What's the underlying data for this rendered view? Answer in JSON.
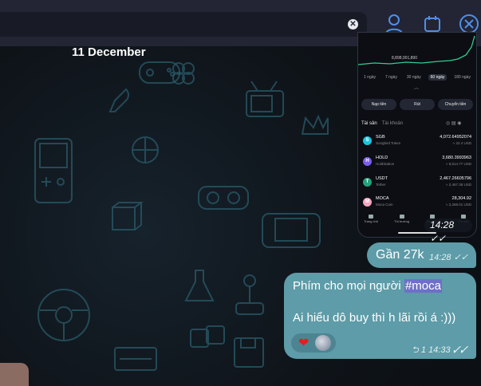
{
  "search": {
    "value": "",
    "clear_icon": "close-circle-icon"
  },
  "topbar": {
    "icons": [
      "person-icon",
      "calendar-icon",
      "close-icon"
    ]
  },
  "chat": {
    "date_label": "11 December",
    "screenshot": {
      "chart_value": "8,898,001,890",
      "ranges": [
        "1 ngày",
        "7 ngày",
        "30 ngày",
        "60 ngày",
        "180 ngày"
      ],
      "active_range": "60 ngày",
      "actions": [
        "Nạp tiền",
        "Rút",
        "Chuyển tiền"
      ],
      "tabs": {
        "active": "Tài sản",
        "other": "Tài khoản"
      },
      "assets": [
        {
          "symbol": "SGB",
          "name": "Songbird Token",
          "amount": "4,072.64952074",
          "usd": "≈ 22.4 USD",
          "color": "#19c6e0",
          "glyph": "S"
        },
        {
          "symbol": "HOLD",
          "name": "HoldStation",
          "amount": "3,680.3993963",
          "usd": "≈ 8,614.77 USD",
          "color": "#7a5cf0",
          "glyph": "H"
        },
        {
          "symbol": "USDT",
          "name": "Tether",
          "amount": "2,467.26605796",
          "usd": "≈ 2,467.36 USD",
          "color": "#26a17b",
          "glyph": "T"
        },
        {
          "symbol": "MOCA",
          "name": "Moca Coin",
          "amount": "28,304.92",
          "usd": "≈ 2,268.01 USD",
          "color": "#f3a6c0",
          "glyph": "M"
        }
      ],
      "nav": [
        "Trang chủ",
        "Thị trường",
        "Giao dịch",
        "Tài sản"
      ],
      "time": "14:28"
    },
    "messages": [
      {
        "text": "Gần 27k",
        "time": "14:28"
      },
      {
        "line1_prefix": "Phím cho mọi người ",
        "hashtag": "#moca",
        "line2": "Ai hiểu dô buy thì h lãi rồi á :)))",
        "views": "1",
        "time": "14:33",
        "reaction": "❤"
      }
    ],
    "check_glyph": "✓✓",
    "reply_glyph": "⮌"
  },
  "colors": {
    "bubble_out": "#5d9ca8",
    "topbar": "#232535",
    "accent": "#4f8fe8"
  }
}
